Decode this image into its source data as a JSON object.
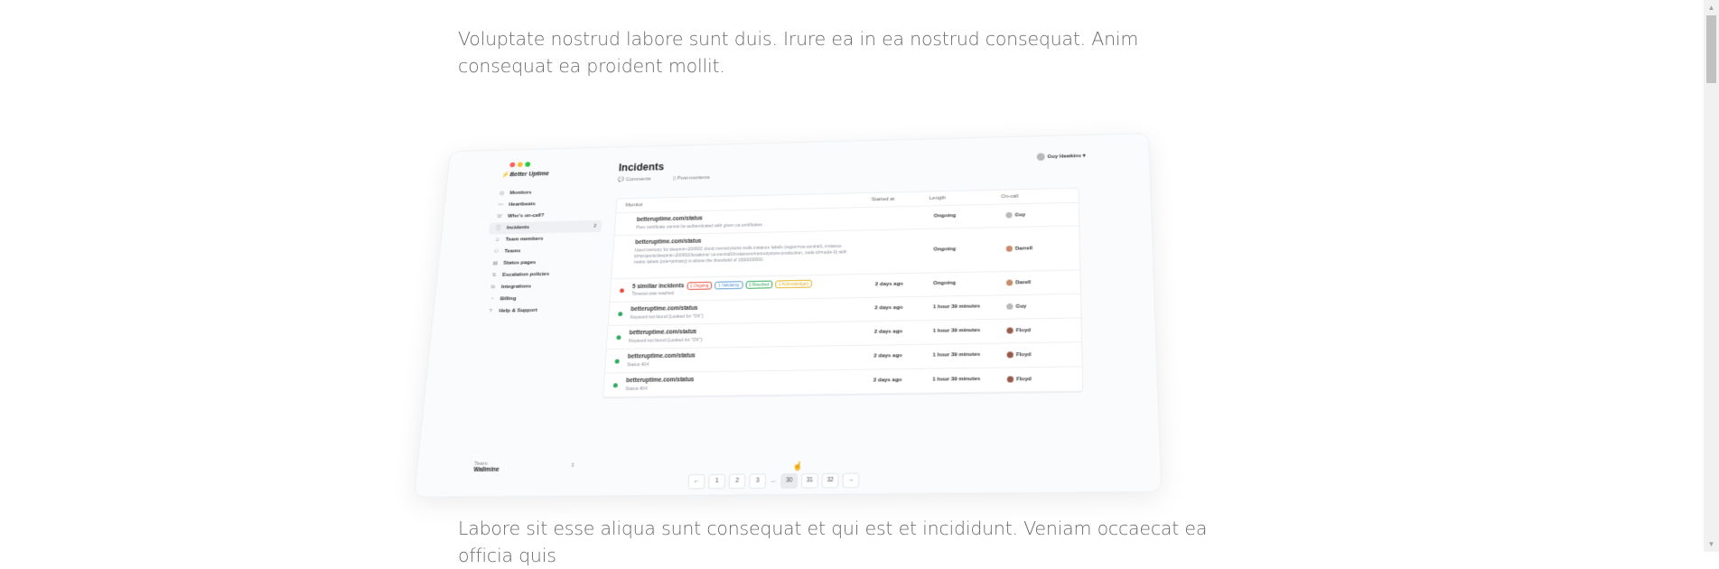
{
  "article": {
    "paragraph_1": "Voluptate nostrud labore sunt duis. Irure ea in ea nostrud consequat. Anim consequat ea proident mollit.",
    "paragraph_2": "Labore sit esse aliqua sunt consequat et qui est et incididunt. Veniam occaecat ea officia quis"
  },
  "app": {
    "brand": "Better Uptime",
    "window_dot_colors": [
      "#ff5f57",
      "#febc2e",
      "#28c840"
    ],
    "sidebar": [
      {
        "label": "Monitors",
        "icon": "globe-icon"
      },
      {
        "label": "Heartbeats",
        "icon": "heartbeat-icon"
      },
      {
        "label": "Who's on-call?",
        "icon": "phone-icon"
      },
      {
        "label": "Incidents",
        "icon": "incident-icon",
        "count": "2",
        "active": true
      },
      {
        "label": "Team members",
        "icon": "user-icon"
      },
      {
        "label": "Teams",
        "icon": "team-icon"
      },
      {
        "label": "Status pages",
        "icon": "status-page-icon"
      },
      {
        "label": "Escalation policies",
        "icon": "escalation-icon"
      },
      {
        "label": "Integrations",
        "icon": "integrations-icon"
      },
      {
        "label": "Billing",
        "icon": "billing-icon"
      },
      {
        "label": "Help & Support",
        "icon": "help-icon"
      }
    ],
    "team": {
      "label": "Team",
      "name": "Wallmine"
    },
    "page_title": "Incidents",
    "subtabs": {
      "comments": "Comments",
      "postmortems": "Post-mortems"
    },
    "user": "Guy Hawkins",
    "table": {
      "headers": {
        "monitor": "Monitor",
        "started": "Started at",
        "length": "Length",
        "oncall": "On-call"
      },
      "rows": [
        {
          "monitor": "betteruptime.com/status",
          "detail": "Peer certificate cannot be authenticated with given ca certificates",
          "started": "",
          "length": "Ongoing",
          "oncall": "Guy",
          "dot": ""
        },
        {
          "monitor": "betteruptime.com/status",
          "detail": "Used memory for deepmin-200602 cloud.memorystore.redis.instance labels (region=us-central1, instance id=projects/deepmin-200602/locations/ us-central1/instances/memorystore-production, node id=node-0) with metric labels {role=primary} is above the threshold of 1500000000.",
          "started": "",
          "length": "Ongoing",
          "oncall": "Darrell",
          "dot": ""
        },
        {
          "monitor": "5 similiar incidents",
          "detail": "Timeout was reached",
          "started": "2 days ago",
          "length": "Ongoing",
          "oncall": "Darell",
          "dot": "#e74c3c",
          "badges": [
            {
              "text": "1 Ongoing",
              "color": "#e74c3c"
            },
            {
              "text": "1 Validating",
              "color": "#5b9bd5"
            },
            {
              "text": "1 Resolved",
              "color": "#2eaa5c"
            },
            {
              "text": "2 Acknowledged",
              "color": "#e0b21f"
            }
          ]
        },
        {
          "monitor": "betteruptime.com/status",
          "detail": "Keyword not found (Looked for \"OK\")",
          "started": "2 days ago",
          "length": "1 hour 39 minutes",
          "oncall": "Guy",
          "dot": "#2eaa5c"
        },
        {
          "monitor": "betteruptime.com/status",
          "detail": "Keyword not found (Looked for \"OK\")",
          "started": "2 days ago",
          "length": "1 hour 39 minutes",
          "oncall": "Floyd",
          "dot": "#2eaa5c"
        },
        {
          "monitor": "betteruptime.com/status",
          "detail": "Status 404",
          "started": "2 days ago",
          "length": "1 hour 39 minutes",
          "oncall": "Floyd",
          "dot": "#2eaa5c"
        },
        {
          "monitor": "betteruptime.com/status",
          "detail": "Status 404",
          "started": "2 days ago",
          "length": "1 hour 39 minutes",
          "oncall": "Floyd",
          "dot": "#2eaa5c"
        }
      ]
    },
    "pagination": {
      "prev": "←",
      "pages": [
        "1",
        "2",
        "3"
      ],
      "ellipsis": "...",
      "pages_end": [
        "30",
        "31",
        "32"
      ],
      "current": "30",
      "next": "→"
    }
  }
}
